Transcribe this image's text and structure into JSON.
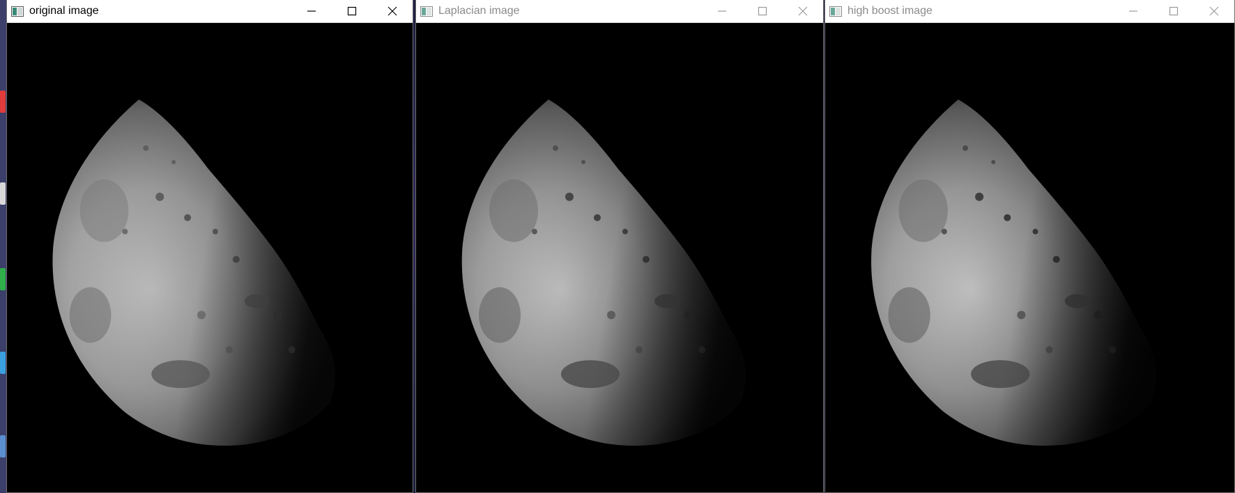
{
  "windows": [
    {
      "title": "original image",
      "active": true,
      "icon": "app-window-icon",
      "controls": [
        "minimize-icon",
        "maximize-icon",
        "close-icon"
      ]
    },
    {
      "title": "Laplacian image",
      "active": false,
      "icon": "app-window-icon",
      "controls": [
        "minimize-icon",
        "maximize-icon",
        "close-icon"
      ]
    },
    {
      "title": "high boost image",
      "active": false,
      "icon": "app-window-icon",
      "controls": [
        "minimize-icon",
        "maximize-icon",
        "close-icon"
      ]
    }
  ],
  "colors": {
    "titlebar_bg": "#ffffff",
    "active_title": "#000000",
    "inactive_title": "#8a8a8a",
    "image_bg": "#000000"
  }
}
